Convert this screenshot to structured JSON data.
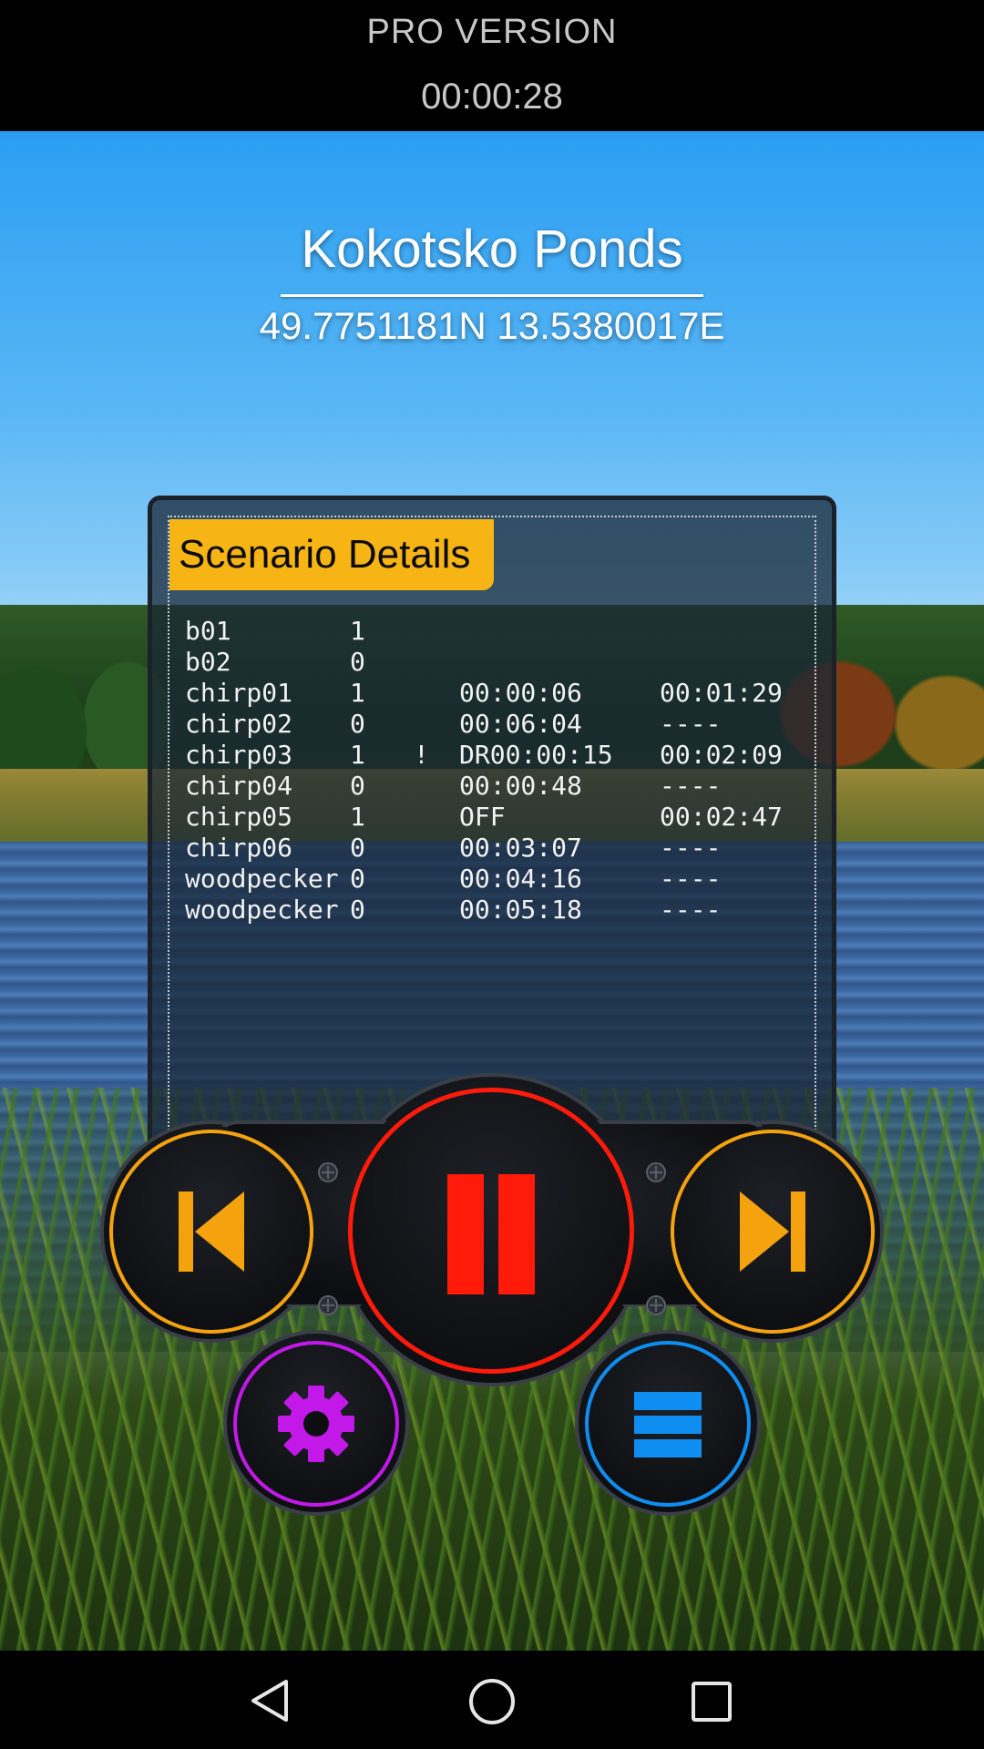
{
  "status_bar": {
    "banner": "PRO VERSION",
    "elapsed": "00:00:28"
  },
  "location": {
    "name": "Kokotsko Ponds",
    "coordinates": "49.7751181N 13.5380017E"
  },
  "scenario": {
    "title": "Scenario Details",
    "rows": [
      {
        "name": "b01",
        "value": "1",
        "flag": "",
        "time": "",
        "end": ""
      },
      {
        "name": "b02",
        "value": "0",
        "flag": "",
        "time": "",
        "end": ""
      },
      {
        "name": "chirp01",
        "value": "1",
        "flag": "",
        "time": "00:00:06",
        "end": "00:01:29"
      },
      {
        "name": "chirp02",
        "value": "0",
        "flag": "",
        "time": "00:06:04",
        "end": "----"
      },
      {
        "name": "chirp03",
        "value": "1",
        "flag": "!",
        "time": "DR00:00:15",
        "end": "00:02:09"
      },
      {
        "name": "chirp04",
        "value": "0",
        "flag": "",
        "time": "00:00:48",
        "end": "----"
      },
      {
        "name": "chirp05",
        "value": "1",
        "flag": "",
        "time": "OFF",
        "end": "00:02:47"
      },
      {
        "name": "chirp06",
        "value": "0",
        "flag": "",
        "time": "00:03:07",
        "end": "----"
      },
      {
        "name": "woodpecker",
        "value": "0",
        "flag": "",
        "time": "00:04:16",
        "end": "----"
      },
      {
        "name": "woodpecker",
        "value": "0",
        "flag": "",
        "time": "00:05:18",
        "end": "----"
      }
    ]
  },
  "controls": {
    "previous": {
      "icon": "skip-previous-icon",
      "color": "#f5a20f"
    },
    "pause": {
      "icon": "pause-icon",
      "color": "#ff1a0a"
    },
    "next": {
      "icon": "skip-next-icon",
      "color": "#f5a20f"
    },
    "settings": {
      "icon": "gear-icon",
      "color": "#c219e8"
    },
    "menu": {
      "icon": "menu-icon",
      "color": "#0f8ef2"
    }
  },
  "nav_bar": {
    "back": "back-icon",
    "home": "home-icon",
    "recents": "recents-icon"
  }
}
